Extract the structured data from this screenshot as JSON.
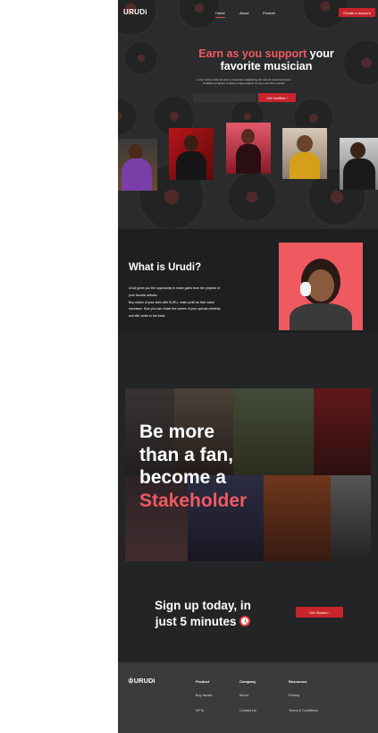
{
  "nav": {
    "logo": "URUDi",
    "links": [
      "Home",
      "About",
      "Product"
    ],
    "cta": "Create a account"
  },
  "hero": {
    "title_accent": "Earn as you support",
    "title_rest_1": " your",
    "title_rest_2": "favorite musician",
    "description": "Lorem ipsum dolor sit amet, consectetur adipiscing elit, sed do eiusmod tempor incididunt ut labore et dolore magna aliqua. Ut enim ad minim veniam",
    "email_placeholder": "",
    "button": "Get Notified",
    "button_arrow": "›"
  },
  "whatis": {
    "title": "What is Urudi?",
    "lines": [
      "Urudi gives you the opportunity to make gains from the projects of",
      "your favorite artistes.",
      "Buy stocks of your idols with SURU, make profit as their value",
      "increases. Now you can chase the names of your special celebrity",
      "and still, smile to the bank."
    ]
  },
  "stake": {
    "line1": "Be more",
    "line2": "than a fan,",
    "line3": "become a",
    "accent": "Stakeholder"
  },
  "signup": {
    "line1": "Sign up today, in",
    "line2": "just 5 minutes",
    "button": "Get Started",
    "button_arrow": "›"
  },
  "footer": {
    "logo": "URUDi",
    "columns": [
      {
        "title": "Product",
        "links": [
          "Buy Issues",
          "NFTs"
        ]
      },
      {
        "title": "Company",
        "links": [
          "About",
          "Contact Us"
        ]
      },
      {
        "title": "Resources",
        "links": [
          "Privacy",
          "Terms & Conditions"
        ]
      }
    ]
  },
  "colors": {
    "accent": "#f05a61",
    "button": "#c8242b",
    "background": "#232426",
    "footer": "#3a3b3c"
  }
}
